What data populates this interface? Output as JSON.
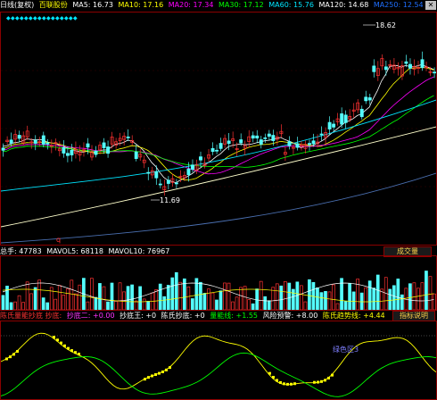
{
  "header": {
    "period": "日线(复权)",
    "stock_name": "百联股份",
    "ma": [
      {
        "label": "MA5: 16.73",
        "color": "#ffffff"
      },
      {
        "label": "MA10: 17.16",
        "color": "#ffff00"
      },
      {
        "label": "MA20: 17.34",
        "color": "#ff00ff"
      },
      {
        "label": "MA30: 17.12",
        "color": "#00ff00"
      },
      {
        "label": "MA60: 15.76",
        "color": "#00e5ff"
      },
      {
        "label": "MA120: 14.68",
        "color": "#ffffff"
      },
      {
        "label": "MA250: 12.54",
        "color": "#1f6fff"
      }
    ]
  },
  "annotations": {
    "high": "18.62",
    "low": "11.69",
    "marker": "q"
  },
  "volume": {
    "total": "总手: 47783",
    "mavol5": "MAVOL5: 68118",
    "mavol10": "MAVOL10: 76967",
    "button": "成交量"
  },
  "indicator": {
    "items": [
      {
        "label": "陈氏量能抄底 抄底: ",
        "color": "#ff3333"
      },
      {
        "label": "抄底二: +0.00",
        "color": "#ff33ff"
      },
      {
        "label": "抄底王: +0",
        "color": "#ffffff"
      },
      {
        "label": "陈氏抄底: +0",
        "color": "#ffffff"
      },
      {
        "label": "量能线: +1.55",
        "color": "#00ff00"
      },
      {
        "label": "风险预警: +8.00",
        "color": "#ffffff"
      },
      {
        "label": "陈氏趋势线: +4.44",
        "color": "#ffff00"
      }
    ],
    "button": "指标说明",
    "tag": "绿色区3"
  },
  "colors": {
    "up": "#ff3232",
    "down": "#54ffff",
    "frame": "#8b0000"
  }
}
